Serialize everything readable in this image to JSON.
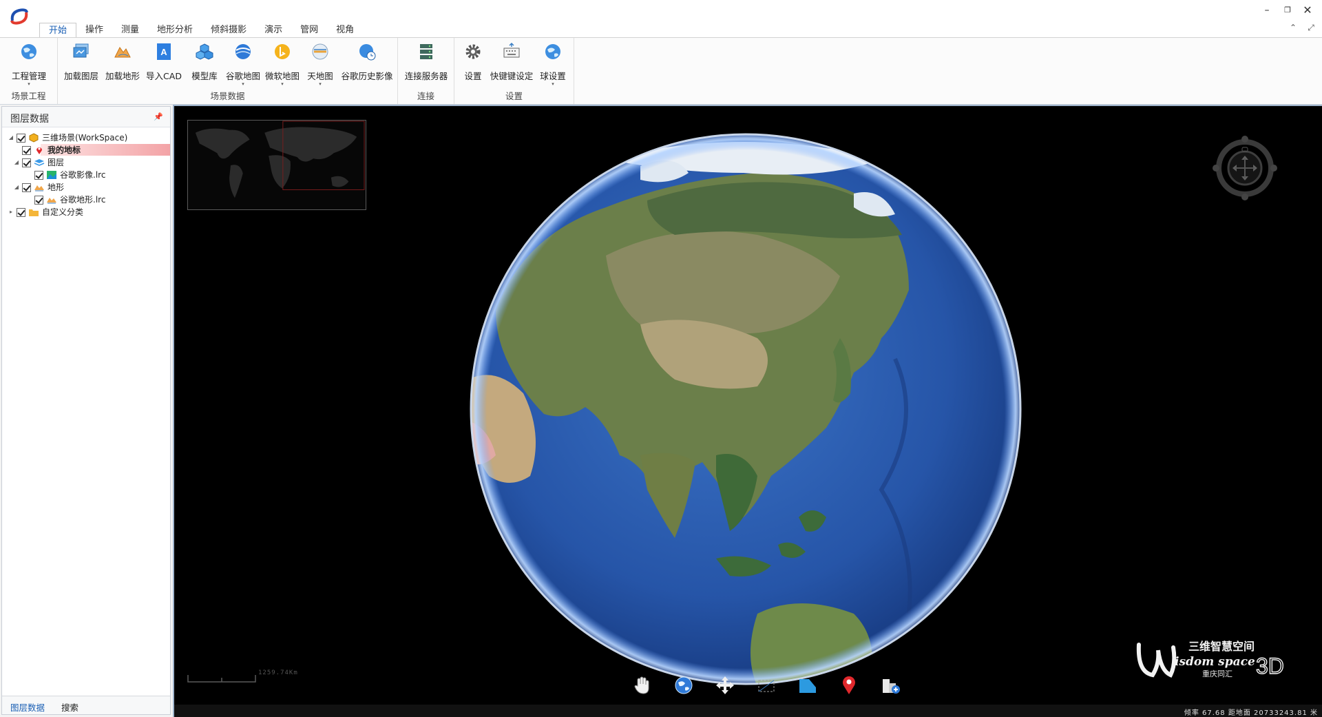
{
  "tabs": [
    "开始",
    "操作",
    "测量",
    "地形分析",
    "倾斜摄影",
    "演示",
    "管网",
    "视角"
  ],
  "ribbon": {
    "groups": {
      "scene_project": "场景工程",
      "scene_data": "场景数据",
      "connect": "连接",
      "settings": "设置"
    },
    "buttons": {
      "project_mgmt": "工程管理",
      "load_layer": "加载图层",
      "load_terrain": "加载地形",
      "import_cad": "导入CAD",
      "model_lib": "模型库",
      "google_map": "谷歌地图",
      "bing_map": "微软地图",
      "tianditu": "天地图",
      "google_history": "谷歌历史影像",
      "connect_server": "连接服务器",
      "settings": "设置",
      "shortcut_settings": "快键键设定",
      "globe_settings": "球设置"
    }
  },
  "left_panel": {
    "title": "图层数据",
    "tree": {
      "workspace": "三维场景(WorkSpace)",
      "my_landmark": "我的地标",
      "layers": "图层",
      "google_imagery": "谷歌影像.lrc",
      "terrain": "地形",
      "google_terrain": "谷歌地形.lrc",
      "custom_category": "自定义分类"
    },
    "bottom_tabs": {
      "layer_data": "图层数据",
      "search": "搜索"
    }
  },
  "viewport": {
    "scale_text": "1259.74Km",
    "brand": {
      "cn": "三维智慧空间",
      "en": "isdom space",
      "tag": "3D",
      "sub": "重庆同汇"
    },
    "status": "倾率 67.68  距地面 20733243.81 米"
  },
  "colors": {
    "accent": "#1a5fb4",
    "selection": "#f3a3a6",
    "viewport_bg": "#000000",
    "ocean": "#2a5cae"
  }
}
